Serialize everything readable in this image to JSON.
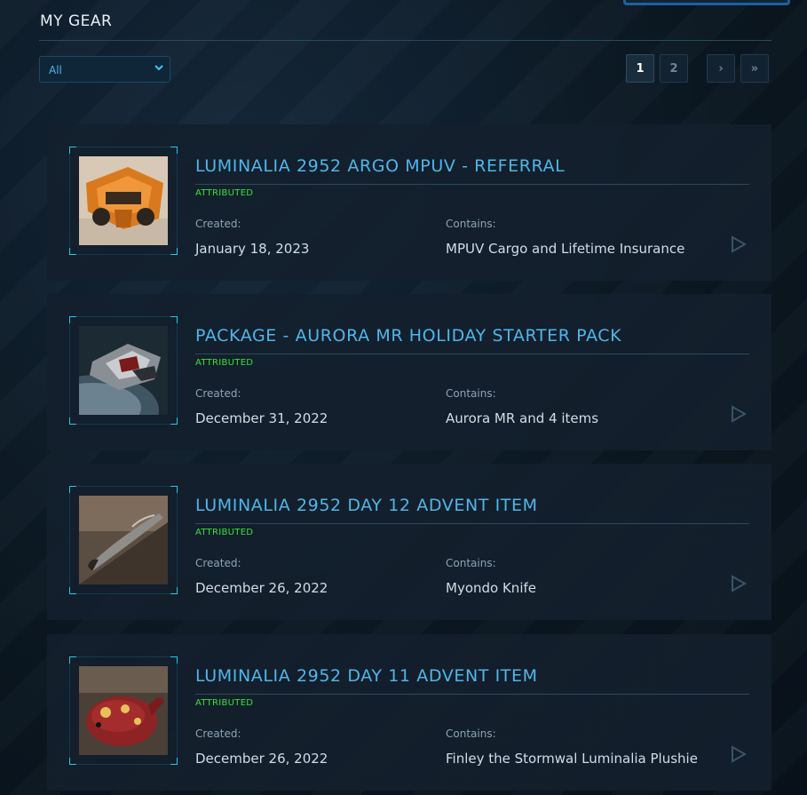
{
  "page": {
    "title": "MY GEAR"
  },
  "filter": {
    "selected": "All",
    "icon": "chevron-down-icon"
  },
  "pagination": {
    "pages": [
      "1",
      "2"
    ],
    "current": "1",
    "next_label": "›",
    "last_label": "»"
  },
  "labels": {
    "created": "Created:",
    "contains": "Contains:"
  },
  "items": [
    {
      "title": "LUMINALIA 2952 ARGO MPUV - REFERRAL",
      "status": "ATTRIBUTED",
      "created": "January 18, 2023",
      "contains": "MPUV Cargo and Lifetime Insurance",
      "thumbnail": "argo-mpuv-ship-image"
    },
    {
      "title": "PACKAGE - AURORA MR HOLIDAY STARTER PACK",
      "status": "ATTRIBUTED",
      "created": "December 31, 2022",
      "contains": "Aurora MR and 4 items",
      "thumbnail": "aurora-mr-ship-image"
    },
    {
      "title": "LUMINALIA 2952 DAY 12 ADVENT ITEM",
      "status": "ATTRIBUTED",
      "created": "December 26, 2022",
      "contains": "Myondo Knife",
      "thumbnail": "knife-image"
    },
    {
      "title": "LUMINALIA 2952 DAY 11 ADVENT ITEM",
      "status": "ATTRIBUTED",
      "created": "December 26, 2022",
      "contains": "Finley the Stormwal Luminalia Plushie",
      "thumbnail": "plushie-image"
    }
  ],
  "colors": {
    "accent": "#4fb6ea",
    "status_green": "#35e23a",
    "corner_cyan": "#25c7e6"
  }
}
